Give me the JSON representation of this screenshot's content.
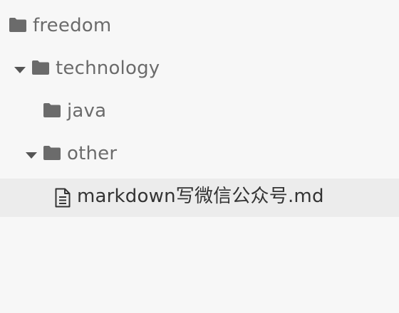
{
  "file_tree": {
    "items": [
      {
        "name": "freedom",
        "type": "folder",
        "expanded": false,
        "selected": false
      },
      {
        "name": "technology",
        "type": "folder",
        "expanded": true,
        "selected": false
      },
      {
        "name": "java",
        "type": "folder",
        "expanded": false,
        "selected": false
      },
      {
        "name": "other",
        "type": "folder",
        "expanded": true,
        "selected": false
      },
      {
        "name": "markdown写微信公众号.md",
        "type": "file",
        "selected": true
      }
    ]
  },
  "colors": {
    "background": "#f7f7f7",
    "selected_row": "#ececec",
    "icon": "#6b6b6b",
    "text": "#6b6b6b",
    "selected_text": "#333333"
  }
}
